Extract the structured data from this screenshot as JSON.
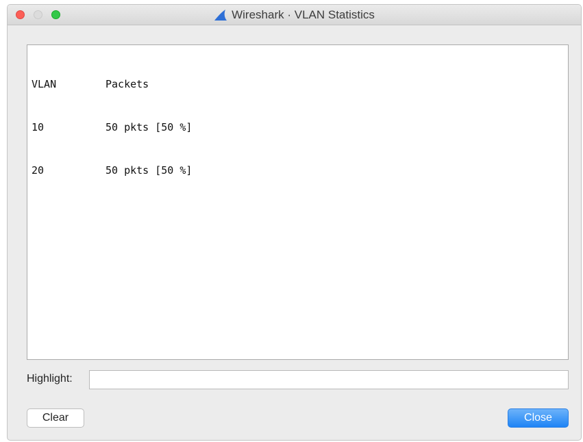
{
  "window": {
    "title": "Wireshark · VLAN Statistics",
    "app_icon": "wireshark-fin-icon"
  },
  "stats": {
    "header": {
      "vlan": "VLAN",
      "packets": "Packets"
    },
    "rows": [
      {
        "vlan": "10",
        "packets": "50 pkts [50 %]"
      },
      {
        "vlan": "20",
        "packets": "50 pkts [50 %]"
      }
    ]
  },
  "highlight": {
    "label": "Highlight:",
    "value": "",
    "placeholder": ""
  },
  "buttons": {
    "clear": "Clear",
    "close": "Close"
  },
  "colors": {
    "window_bg": "#ececec",
    "accent_button": "#1e84f5",
    "fin_icon": "#2e6fd6"
  }
}
